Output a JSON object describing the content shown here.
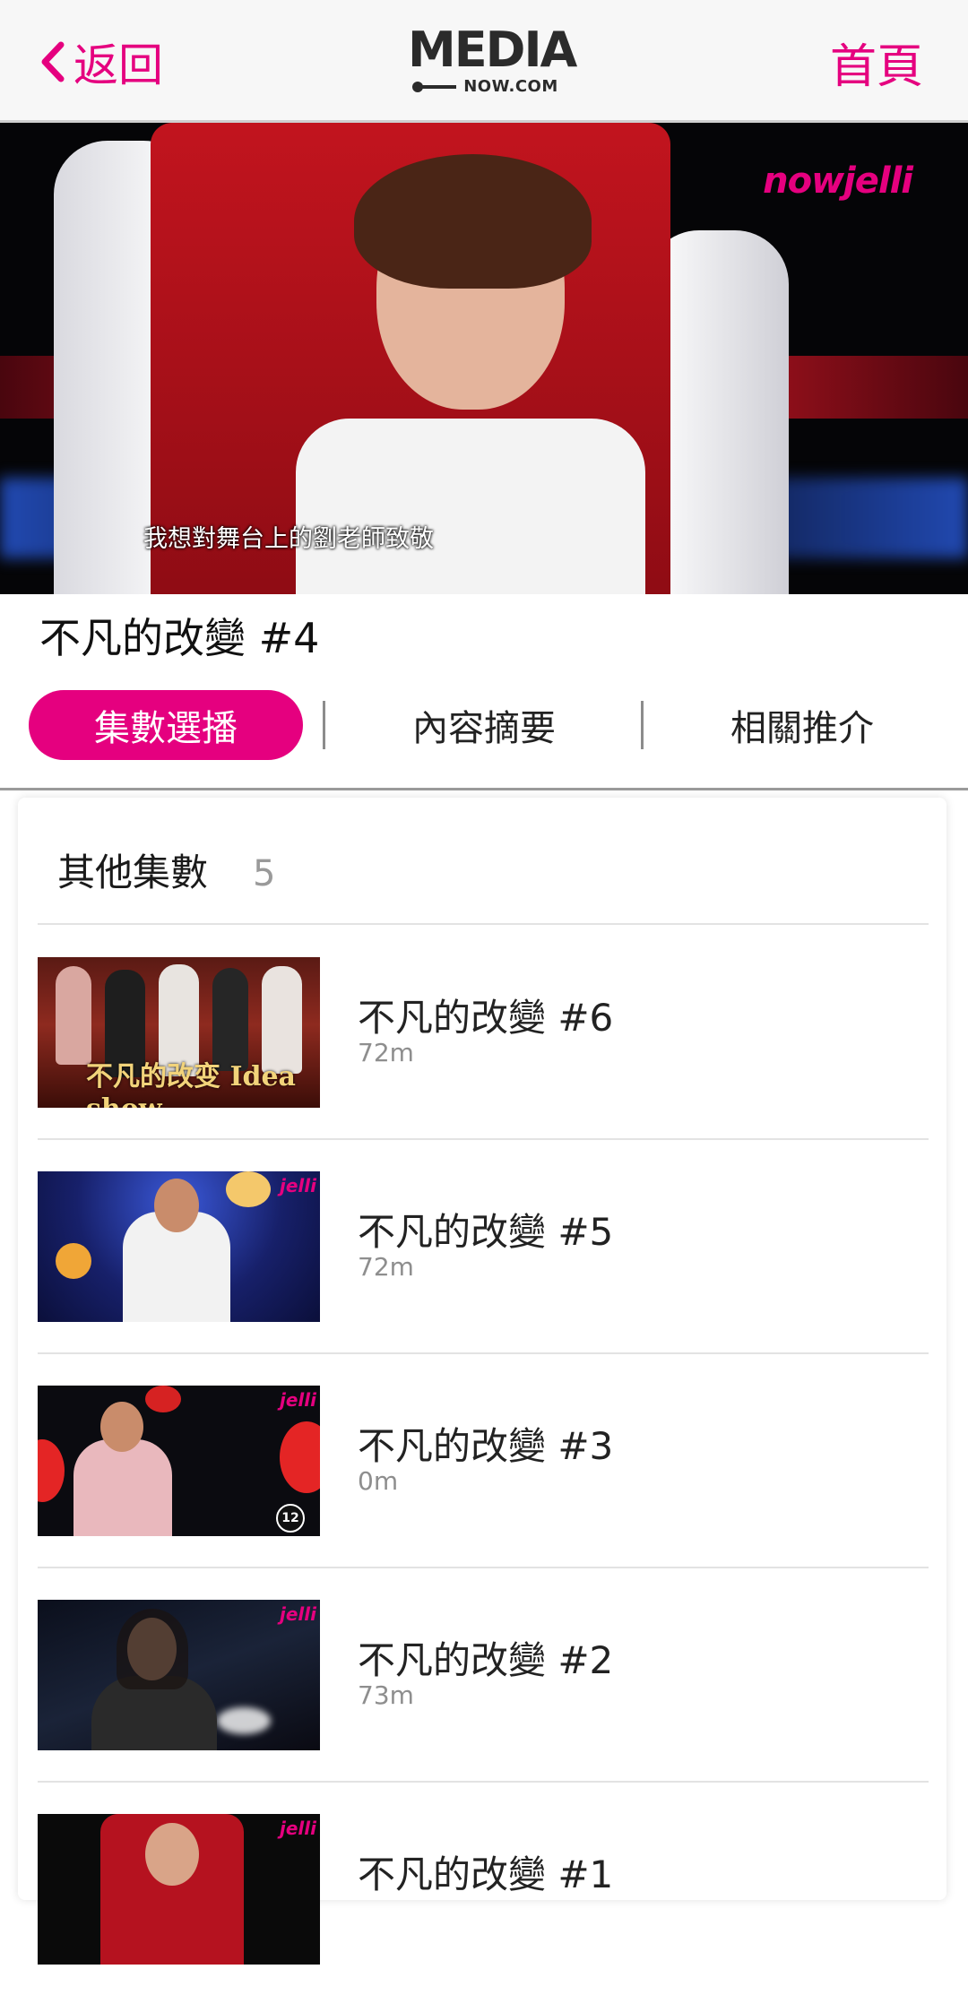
{
  "header": {
    "back_label": "返回",
    "logo_main": "MEDIA",
    "logo_sub": "NOW.COM",
    "home_label": "首頁"
  },
  "player": {
    "channel_logo": "nowjelli",
    "subtitle": "我想對舞台上的劉老師致敬"
  },
  "episode": {
    "title": "不凡的改變 #4"
  },
  "tabs": [
    {
      "label": "集數選播",
      "active": true
    },
    {
      "label": "內容摘要",
      "active": false
    },
    {
      "label": "相關推介",
      "active": false
    }
  ],
  "episodes_panel": {
    "heading": "其他集數",
    "count": "5",
    "items": [
      {
        "title": "不凡的改變 #6",
        "duration": "72m",
        "thumb_text": "不凡的改变 Idea show"
      },
      {
        "title": "不凡的改變 #5",
        "duration": "72m"
      },
      {
        "title": "不凡的改變 #3",
        "duration": "0m",
        "badge": "12"
      },
      {
        "title": "不凡的改變 #2",
        "duration": "73m"
      },
      {
        "title": "不凡的改變 #1",
        "duration": ""
      }
    ]
  },
  "colors": {
    "accent": "#e5007f",
    "header_bg": "#f7f7f7",
    "muted_text": "#8e8e8e"
  }
}
